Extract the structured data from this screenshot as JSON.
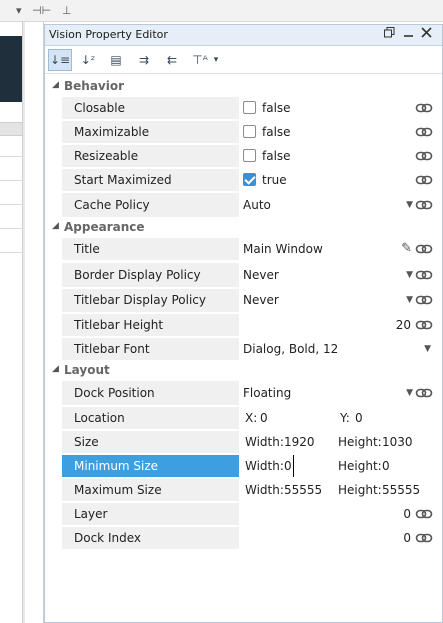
{
  "host_toolbar": {
    "dropdown_icon": "▾",
    "split_icon": "⊣⊢",
    "pin_icon": "⊥"
  },
  "window": {
    "title": "Vision Property Editor"
  },
  "toolbar": {
    "buttons": [
      {
        "icon": "sort-categorized-icon",
        "glyph": "↓≡"
      },
      {
        "icon": "sort-alpha-icon",
        "glyph": "↓ᶻ"
      },
      {
        "icon": "list-view-icon",
        "glyph": "▤"
      },
      {
        "icon": "expand-all-icon",
        "glyph": "⇉"
      },
      {
        "icon": "collapse-all-icon",
        "glyph": "⇇"
      },
      {
        "icon": "filter-icon",
        "glyph": "⊤ᴬ"
      },
      {
        "icon": "filter-dropdown-icon",
        "glyph": "▾"
      }
    ]
  },
  "sections": {
    "behavior": {
      "label": "Behavior",
      "rows": {
        "closable": {
          "name": "Closable",
          "value": "false"
        },
        "maximizable": {
          "name": "Maximizable",
          "value": "false"
        },
        "resizeable": {
          "name": "Resizeable",
          "value": "false"
        },
        "start_maximized": {
          "name": "Start Maximized",
          "value": "true"
        },
        "cache_policy": {
          "name": "Cache Policy",
          "value": "Auto"
        }
      }
    },
    "appearance": {
      "label": "Appearance",
      "rows": {
        "title": {
          "name": "Title",
          "value": "Main Window"
        },
        "border_display_policy": {
          "name": "Border Display Policy",
          "value": "Never"
        },
        "titlebar_display_policy": {
          "name": "Titlebar Display Policy",
          "value": "Never"
        },
        "titlebar_height": {
          "name": "Titlebar Height",
          "value": "20"
        },
        "titlebar_font": {
          "name": "Titlebar Font",
          "value": "Dialog, Bold, 12"
        }
      }
    },
    "layout": {
      "label": "Layout",
      "rows": {
        "dock_position": {
          "name": "Dock Position",
          "value": "Floating"
        },
        "location": {
          "name": "Location",
          "x_label": "X:",
          "x": "0",
          "y_label": "Y:",
          "y": "0"
        },
        "size": {
          "name": "Size",
          "w_label": "Width:",
          "w": "1920",
          "h_label": "Height:",
          "h": "1030"
        },
        "minimum_size": {
          "name": "Minimum Size",
          "w_label": "Width:",
          "w": "0",
          "h_label": "Height:",
          "h": "0"
        },
        "maximum_size": {
          "name": "Maximum Size",
          "w_label": "Width:",
          "w": "55555",
          "h_label": "Height:",
          "h": "55555"
        },
        "layer": {
          "name": "Layer",
          "value": "0"
        },
        "dock_index": {
          "name": "Dock Index",
          "value": "0"
        }
      }
    }
  },
  "colors": {
    "selection": "#3d9ee0",
    "accent": "#3d8fd6"
  }
}
